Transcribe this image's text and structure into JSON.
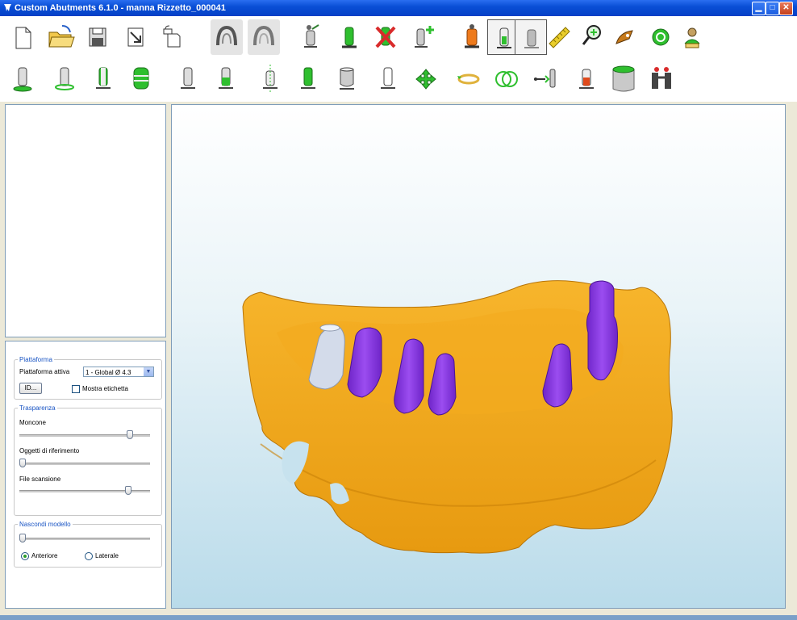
{
  "window": {
    "title": "Custom Abutments 6.1.0 - manna Rizzetto_000041",
    "controls": [
      "minimize",
      "maximize",
      "close"
    ]
  },
  "toolbar": {
    "row1": [
      {
        "name": "new-file-icon"
      },
      {
        "name": "open-folder-icon"
      },
      {
        "name": "save-icon"
      },
      {
        "name": "export-icon"
      },
      {
        "name": "copy-icon"
      },
      {
        "name": "upper-arch-icon"
      },
      {
        "name": "lower-arch-icon"
      },
      {
        "name": "implant-tool-icon"
      },
      {
        "name": "green-abutment-icon"
      },
      {
        "name": "delete-abutment-icon"
      },
      {
        "name": "add-abutment-icon"
      },
      {
        "name": "orange-abutment-icon"
      },
      {
        "name": "abutment-view-icon"
      },
      {
        "name": "abutment-gray-icon"
      },
      {
        "name": "ruler-icon"
      },
      {
        "name": "zoom-icon"
      },
      {
        "name": "paint-tool-icon"
      },
      {
        "name": "refresh-icon"
      },
      {
        "name": "user-info-icon"
      }
    ],
    "row2": [
      {
        "name": "abutment-base-icon"
      },
      {
        "name": "abutment-margin-icon"
      },
      {
        "name": "abutment-body-icon"
      },
      {
        "name": "abutment-wide-icon"
      },
      {
        "name": "abutment-plain-icon"
      },
      {
        "name": "abutment-green-top-icon"
      },
      {
        "name": "abutment-axis-icon"
      },
      {
        "name": "abutment-green-body-icon"
      },
      {
        "name": "abutment-cylinder-icon"
      },
      {
        "name": "abutment-outline-icon"
      },
      {
        "name": "move-icon"
      },
      {
        "name": "rotate-icon"
      },
      {
        "name": "align-rings-icon"
      },
      {
        "name": "connect-icon"
      },
      {
        "name": "abutment-red-icon"
      },
      {
        "name": "cylinder-icon"
      },
      {
        "name": "help-icon"
      }
    ]
  },
  "panel": {
    "platform": {
      "legend": "Piattaforma",
      "active_label": "Piattaforma attiva",
      "active_value": "1 - Global Ø 4.3",
      "id_button": "ID...",
      "show_label": "Mostra etichetta"
    },
    "transparency": {
      "legend": "Trasparenza",
      "sliders": [
        {
          "label": "Moncone",
          "value": 0.82
        },
        {
          "label": "Oggetti di riferimento",
          "value": 0.0
        },
        {
          "label": "File scansione",
          "value": 0.81
        }
      ]
    },
    "hide_model": {
      "legend": "Nascondi modello",
      "slider_value": 0.0,
      "radio_anterior": "Anteriore",
      "radio_lateral": "Laterale",
      "selected": "Anteriore"
    }
  },
  "colors": {
    "model": "#f4a91a",
    "abutment": "#8e3fe3",
    "scan_body": "#c8d0e0",
    "accent_green": "#2fbf2f"
  }
}
